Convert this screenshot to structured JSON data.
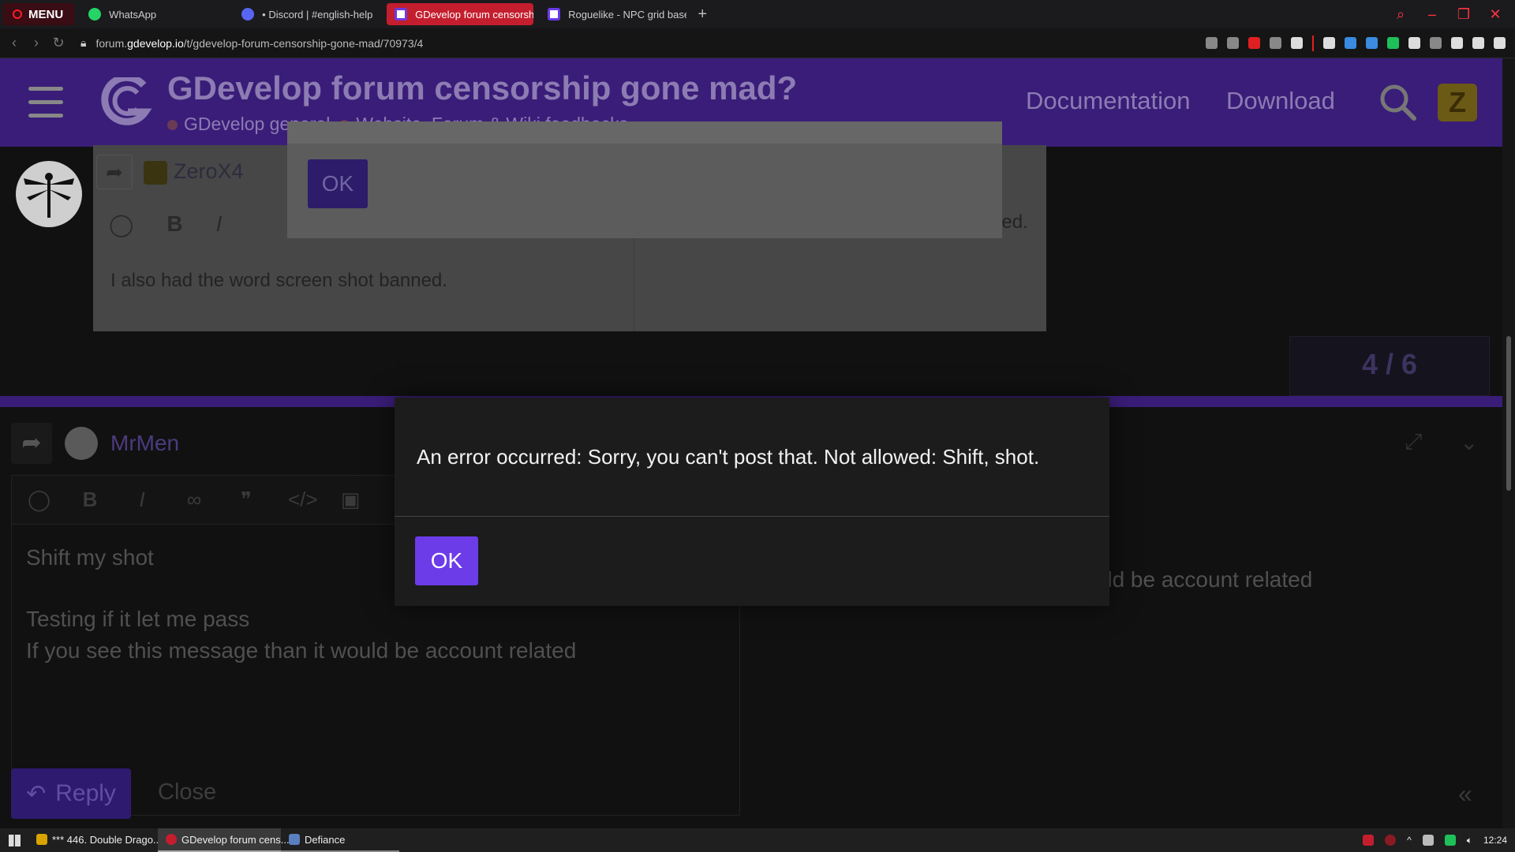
{
  "browser": {
    "menu_label": "MENU",
    "tabs": [
      {
        "label": "WhatsApp"
      },
      {
        "label": "• Discord | #english-help"
      },
      {
        "label": "GDevelop forum censorsh"
      },
      {
        "label": "Roguelike - NPC grid base"
      }
    ],
    "new_tab": "+",
    "url_prefix": "forum.",
    "url_domain": "gdevelop.io",
    "url_path": "/t/gdevelop-forum-censorship-gone-mad/70973/4"
  },
  "site": {
    "topic_title": "GDevelop forum censorship gone mad?",
    "crumbs": [
      "GDevelop general",
      "Website, Forum & Wiki feedbacks"
    ],
    "nav": [
      "Documentation",
      "Download"
    ]
  },
  "background": {
    "dialog_ok": "OK",
    "quoted_user": "ZeroX4",
    "post_text": "I also had the word screen shot banned.",
    "post_text_right": "ned.",
    "progress": "4 / 6"
  },
  "composer": {
    "username": "MrMen",
    "editor_lines": [
      "Shift my shot",
      "",
      "Testing if it let me pass",
      "If you see this message than it would be account related"
    ],
    "preview_lines": [
      "Testing if it let me pass",
      "If you see this message than it would be account related"
    ],
    "reply_label": "Reply",
    "close_label": "Close"
  },
  "modal": {
    "message": "An error occurred: Sorry, you can't post that. Not allowed: Shift, shot.",
    "ok_label": "OK"
  },
  "taskbar": {
    "items": [
      {
        "label": "*** 446. Double Drago..."
      },
      {
        "label": "GDevelop forum cens..."
      },
      {
        "label": "Defiance"
      }
    ],
    "clock": "12:24"
  },
  "colors": {
    "accent": "#6c3ce9",
    "header_bg": "#3a1d78",
    "opera_red": "#c41e2e"
  }
}
